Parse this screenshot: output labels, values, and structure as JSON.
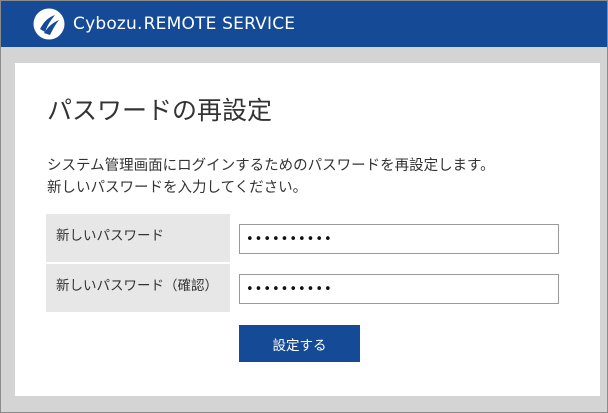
{
  "header": {
    "brand_cybozu": "Cybozu",
    "brand_dot": ".",
    "brand_service": "REMOTE SERVICE",
    "logo_icon": "cybozu-logo-icon",
    "background_color": "#154a96"
  },
  "main": {
    "title": "パスワードの再設定",
    "description_line1": "システム管理画面にログインするためのパスワードを再設定します。",
    "description_line2": "新しいパスワードを入力してください。",
    "form": {
      "new_password_label": "新しいパスワード",
      "new_password_value": "xxxxxxxxxx",
      "confirm_password_label": "新しいパスワード（確認）",
      "confirm_password_value": "xxxxxxxxxx"
    },
    "submit_label": "設定する"
  },
  "colors": {
    "accent": "#154a96",
    "label_bg": "#e7e7e7",
    "page_bg": "#d4d4d4"
  }
}
